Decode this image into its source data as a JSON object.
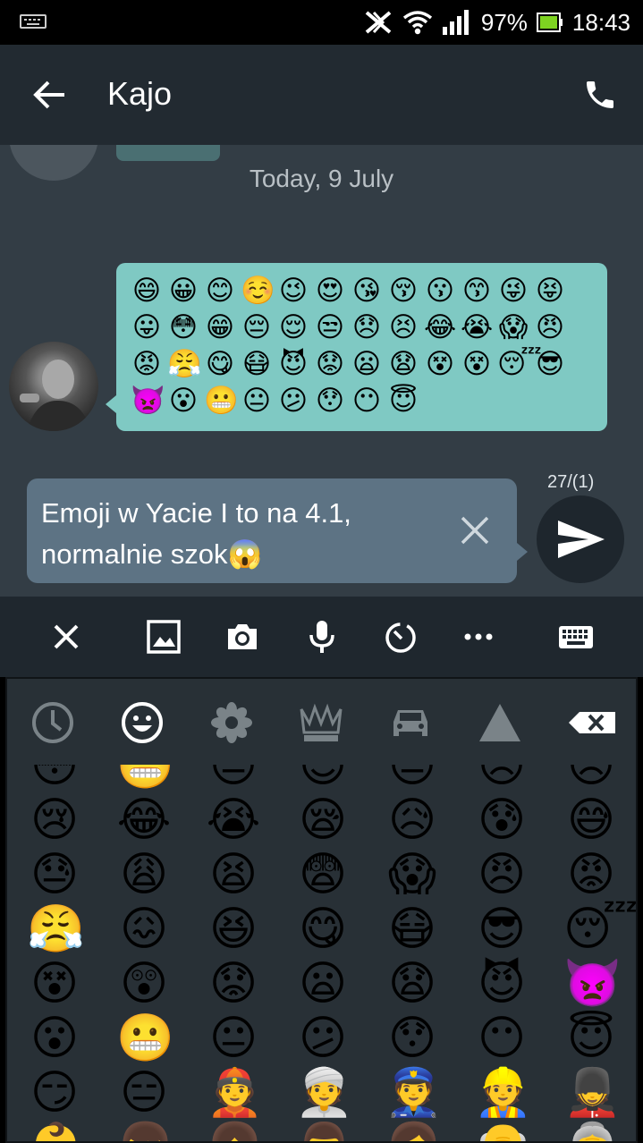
{
  "status_bar": {
    "battery": "97%",
    "time": "18:43"
  },
  "app_bar": {
    "title": "Kajo"
  },
  "chat": {
    "date_label": "Today, 9 July",
    "message_emojis": [
      [
        "😄",
        "😀",
        "😊",
        "☺️",
        "😉",
        "😍",
        "😘",
        "😚",
        "😗",
        "😙",
        "😜",
        "😝"
      ],
      [
        "😛",
        "😳",
        "😁",
        "😔",
        "😌",
        "😒",
        "😞",
        "😣",
        "😂",
        "😭",
        "😱",
        "😠"
      ],
      [
        "😡",
        "😤",
        "😋",
        "😷",
        "😈",
        "😟",
        "😦",
        "😧",
        "😵",
        "😵",
        "😴",
        "😎"
      ],
      [
        "👿",
        "😮",
        "😬",
        "😐",
        "😕",
        "😯",
        "😶",
        "😇"
      ]
    ]
  },
  "composer": {
    "text": "Emoji w Yacie I to na 4.1, normalnie szok😱",
    "char_counter": "27/(1)"
  },
  "keyboard": {
    "tabs": [
      "recent",
      "people",
      "nature",
      "objects",
      "places",
      "symbols"
    ],
    "emoji_rows": [
      [
        "😳",
        "😬",
        "😔",
        "😌",
        "😒",
        "😞",
        "😣"
      ],
      [
        "😢",
        "😂",
        "😭",
        "😪",
        "😥",
        "😰",
        "😅"
      ],
      [
        "😓",
        "😩",
        "😫",
        "😨",
        "😱",
        "😠",
        "😡"
      ],
      [
        "😤",
        "😖",
        "😆",
        "😋",
        "😷",
        "😎",
        "😴"
      ],
      [
        "😵",
        "😲",
        "😟",
        "😦",
        "😧",
        "😈",
        "👿"
      ],
      [
        "😮",
        "😬",
        "😐",
        "😕",
        "😯",
        "😶",
        "😇"
      ],
      [
        "😏",
        "😑",
        "👲",
        "👳",
        "👮",
        "👷",
        "💂"
      ],
      [
        "👶",
        "👦",
        "👧",
        "👨",
        "👩",
        "👴",
        "👵"
      ]
    ]
  }
}
